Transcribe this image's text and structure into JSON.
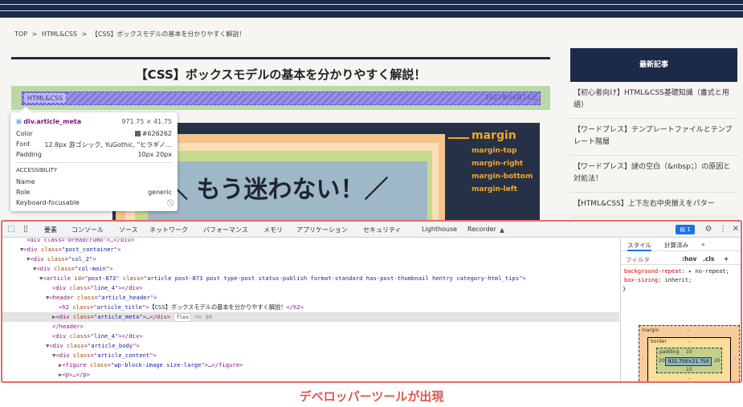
{
  "site": {
    "breadcrumb": [
      "TOP",
      ">",
      "HTML&CSS",
      ">",
      "【CSS】ボックスモデルの基本を分かりやすく解説！"
    ],
    "article_title": "【CSS】ボックスモデルの基本を分かりやすく解説！",
    "meta": {
      "category": "HTML&CSS",
      "date": "2022年04月14日"
    },
    "hero": {
      "text": "＼ もう迷わない！／",
      "legend_title": "margin",
      "legend_items": [
        "margin-top",
        "margin-right",
        "margin-bottom",
        "margin-left"
      ]
    },
    "sidebar": {
      "heading": "最新記事",
      "items": [
        "【初心者向け】HTML&CSS基礎知識（書式と用語）",
        "【ワードプレス】テンプレートファイルとテンプレート階層",
        "【ワードプレス】謎の空白（&nbsp；）の原因と対処法！",
        "【HTML&CSS】上下左右中央揃えをパター"
      ]
    }
  },
  "tooltip": {
    "selector": "div.article_meta",
    "dimensions": "971.75 × 41.75",
    "rows": [
      {
        "label": "Color",
        "value": "#626262"
      },
      {
        "label": "Font",
        "value": "12.8px 游ゴシック, YuGothic, \"ヒラギノ…"
      },
      {
        "label": "Padding",
        "value": "10px 20px"
      }
    ],
    "accessibility_heading": "ACCESSIBILITY",
    "a11y_rows": [
      {
        "label": "Name",
        "value": ""
      },
      {
        "label": "Role",
        "value": "generic"
      },
      {
        "label": "Keyboard-focusable",
        "value": "⃠"
      }
    ]
  },
  "devtools": {
    "tabs": [
      "要素",
      "コンソール",
      "ソース",
      "ネットワーク",
      "パフォーマンス",
      "メモリ",
      "アプリケーション",
      "セキュリティ",
      "Lighthouse",
      "Recorder"
    ],
    "issues_count": "1",
    "dom_lines": [
      {
        "indent": 2,
        "tri": "",
        "html": "<div class=\"breadcrumb\">…</div>"
      },
      {
        "indent": 2,
        "tri": "▼",
        "tag": "div",
        "attrs": [
          [
            "class",
            "post_container"
          ]
        ]
      },
      {
        "indent": 3,
        "tri": "▼",
        "tag": "div",
        "attrs": [
          [
            "class",
            "col_2"
          ]
        ]
      },
      {
        "indent": 4,
        "tri": "▼",
        "tag": "div",
        "attrs": [
          [
            "class",
            "col-main"
          ]
        ]
      },
      {
        "indent": 5,
        "tri": "▼",
        "tag": "article",
        "attrs": [
          [
            "id",
            "post-873"
          ],
          [
            "class",
            "article post-873 post type-post status-publish format-standard has-post-thumbnail hentry category-html_tips"
          ]
        ]
      },
      {
        "indent": 6,
        "tri": "",
        "tag": "div",
        "attrs": [
          [
            "class",
            "line_4"
          ]
        ],
        "close": true,
        "inner": ""
      },
      {
        "indent": 6,
        "tri": "▼",
        "tag": "header",
        "attrs": [
          [
            "class",
            "article_header"
          ]
        ]
      },
      {
        "indent": 7,
        "tri": "",
        "tag": "h2",
        "attrs": [
          [
            "class",
            "article_title"
          ]
        ],
        "close": true,
        "inner": "【CSS】ボックスモデルの基本を分かりやすく解説！"
      },
      {
        "indent": 7,
        "tri": "▶",
        "tag": "div",
        "attrs": [
          [
            "class",
            "article_meta"
          ]
        ],
        "close": true,
        "inner": "…",
        "selected": true,
        "pill": "flex",
        "eq": "== $0"
      },
      {
        "indent": 6,
        "tri": "",
        "endtag": "header"
      },
      {
        "indent": 6,
        "tri": "",
        "tag": "div",
        "attrs": [
          [
            "class",
            "line_4"
          ]
        ],
        "close": true,
        "inner": ""
      },
      {
        "indent": 6,
        "tri": "▼",
        "tag": "div",
        "attrs": [
          [
            "class",
            "article_body"
          ]
        ]
      },
      {
        "indent": 7,
        "tri": "▼",
        "tag": "div",
        "attrs": [
          [
            "class",
            "article_content"
          ]
        ]
      },
      {
        "indent": 8,
        "tri": "▶",
        "tag": "figure",
        "attrs": [
          [
            "class",
            "wp-block-image size-large"
          ]
        ],
        "close": true,
        "inner": "…"
      },
      {
        "indent": 8,
        "tri": "▶",
        "tag": "p",
        "attrs": [],
        "close": true,
        "inner": "…"
      },
      {
        "indent": 8,
        "tri": "▶",
        "tag": "p",
        "attrs": [],
        "close": true,
        "inner": "…"
      }
    ],
    "styles": {
      "tabs": [
        "スタイル",
        "計算済み",
        "»"
      ],
      "filter_placeholder": "フィルタ",
      "filter_buttons": [
        ":hov",
        ".cls",
        "+"
      ],
      "css_lines": [
        {
          "prop": "background-repeat",
          "value": "▸ no-repeat;"
        },
        {
          "prop": "box-sizing",
          "value": "inherit;"
        },
        {
          "prop": "}",
          "value": ""
        }
      ],
      "box_model": {
        "margin_label": "margin",
        "margin_value": "-",
        "border_label": "border",
        "border_value": "-",
        "padding_label": "padding",
        "padding_top": "10",
        "padding_bottom": "10",
        "padding_left": "20",
        "padding_right": "20",
        "content": "931.750×21.750",
        "outer_dash": "-"
      }
    }
  },
  "caption": "デベロッパーツールが出現"
}
